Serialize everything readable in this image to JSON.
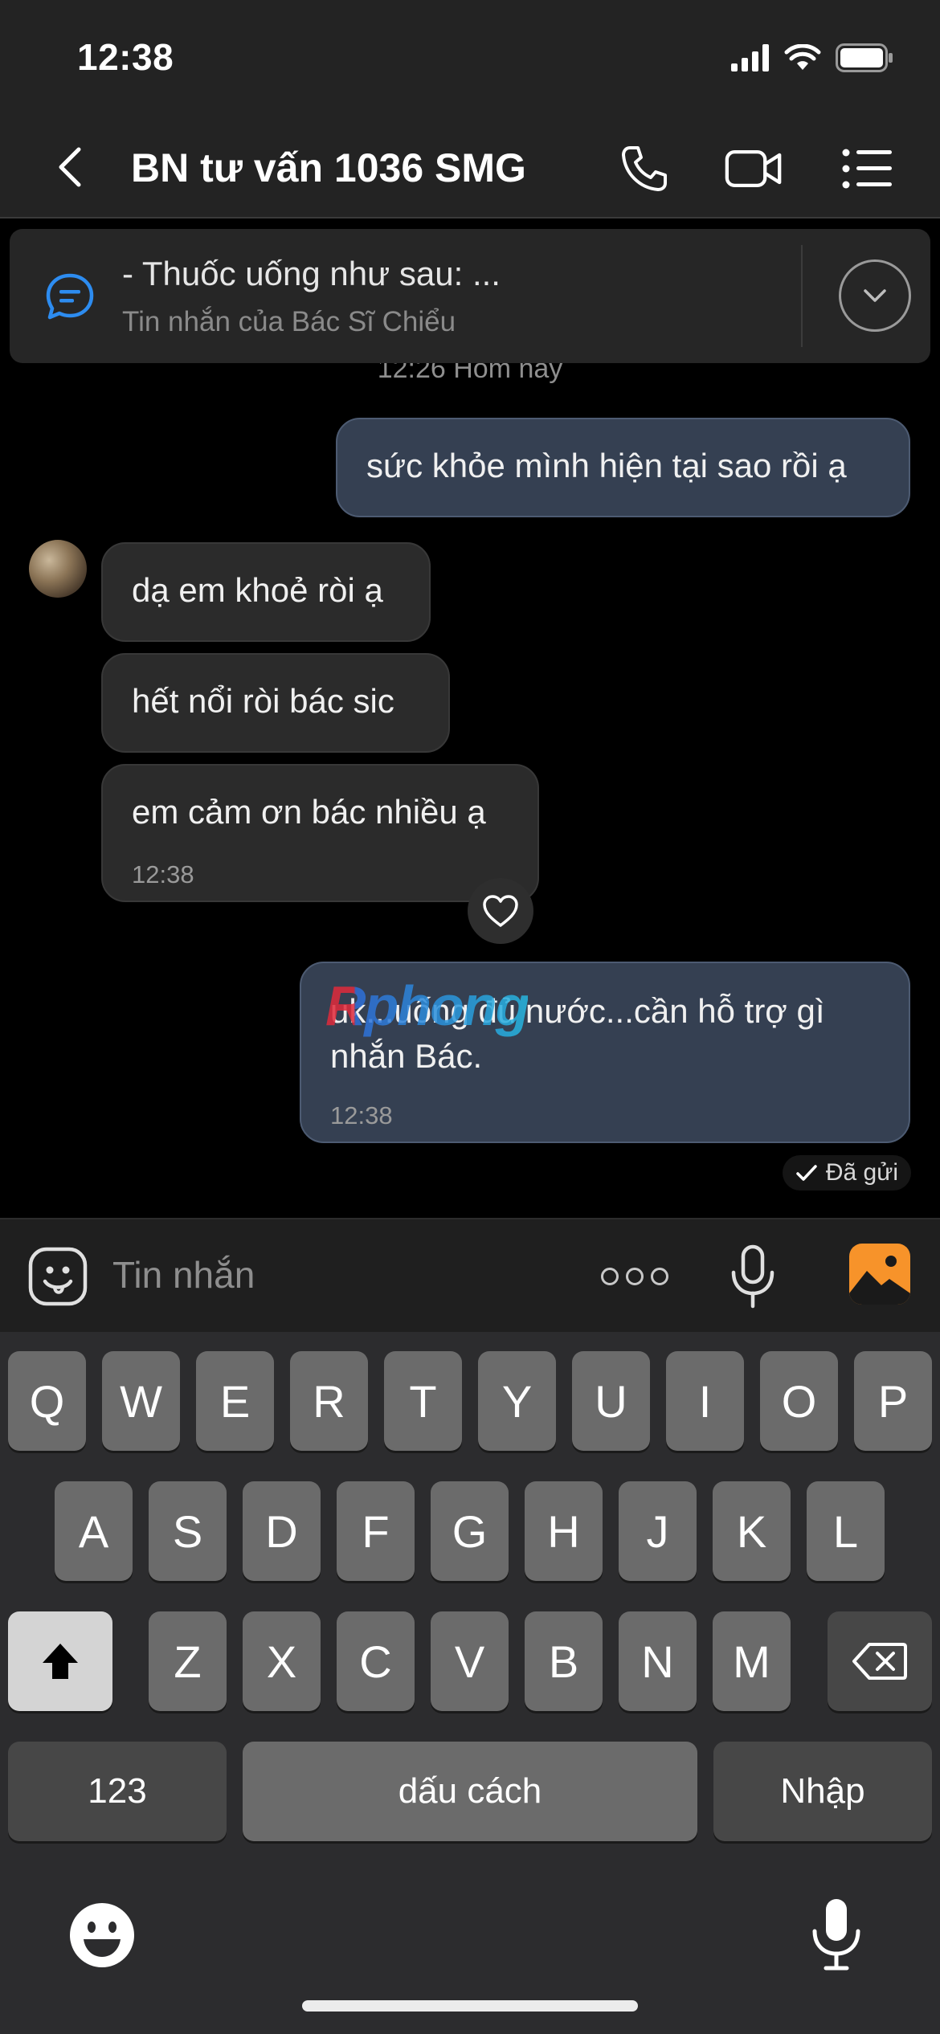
{
  "status_bar": {
    "time": "12:38"
  },
  "header": {
    "title": "BN tư vấn 1036 SMG"
  },
  "pinned": {
    "text": "- Thuốc uống như sau: ...",
    "subtitle": "Tin nhắn của Bác Sĩ Chiểu"
  },
  "timestamp": "12:26 Hôm nay",
  "messages": [
    {
      "direction": "out",
      "text": "sức khỏe mình hiện tại sao rồi ạ"
    },
    {
      "direction": "in",
      "text": "dạ em khoẻ ròi ạ"
    },
    {
      "direction": "in",
      "text": "hết nổi ròi bác sic"
    },
    {
      "direction": "in",
      "text": "em cảm ơn bác nhiều ạ",
      "time": "12:38"
    },
    {
      "direction": "out",
      "text_line1": "uk...uống đủ nước...cần hỗ trợ gì",
      "text_line2": "nhắn Bác.",
      "time": "12:38"
    }
  ],
  "watermark": "Rphong",
  "delivery_status": "Đã gửi",
  "composer": {
    "placeholder": "Tin nhắn"
  },
  "keyboard": {
    "row1": [
      "Q",
      "W",
      "E",
      "R",
      "T",
      "Y",
      "U",
      "I",
      "O",
      "P"
    ],
    "row2": [
      "A",
      "S",
      "D",
      "F",
      "G",
      "H",
      "J",
      "K",
      "L"
    ],
    "row3": [
      "Z",
      "X",
      "C",
      "V",
      "B",
      "N",
      "M"
    ],
    "numbers": "123",
    "space": "dấu cách",
    "enter": "Nhập"
  },
  "icons": {
    "back": "chevron-left-icon",
    "call": "phone-icon",
    "video": "video-camera-icon",
    "menu": "list-icon",
    "pinned": "chat-bubble-icon",
    "expand": "chevron-down-icon",
    "react": "heart-icon",
    "sticker": "smiley-sticker-icon",
    "more": "more-dots-icon",
    "mic": "microphone-icon",
    "photo": "image-icon",
    "shift": "shift-icon",
    "delete": "backspace-icon",
    "emoji": "emoji-icon",
    "dictation": "dictation-icon"
  },
  "colors": {
    "outgoing_bubble": "#354052",
    "incoming_bubble": "#2b2b2b",
    "photo_button": "#f7932a",
    "pinned_icon": "#2d8cf0"
  }
}
